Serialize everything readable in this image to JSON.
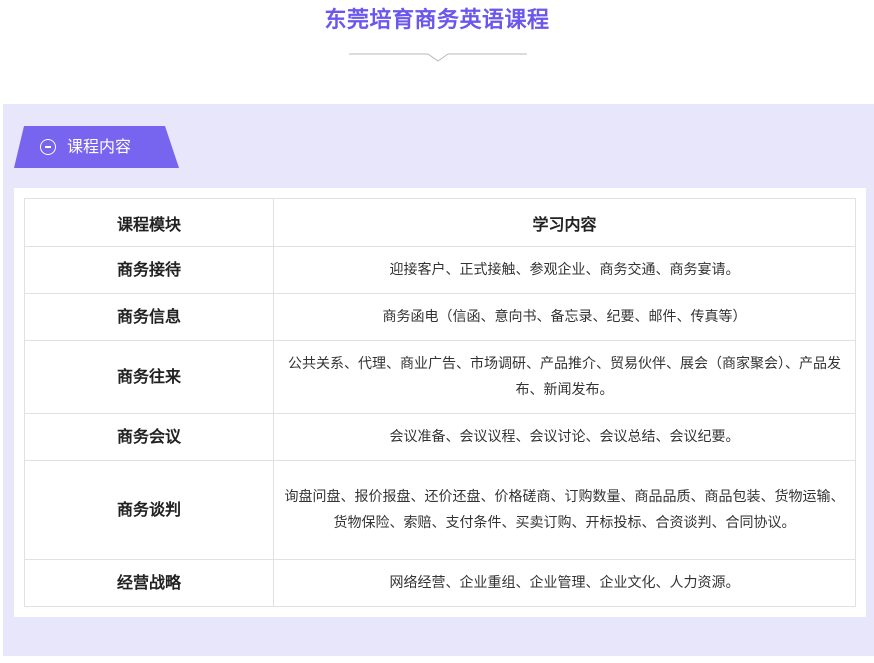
{
  "page": {
    "title": "东莞培育商务英语课程"
  },
  "section": {
    "tab_label": "课程内容",
    "icon": "minus-circle-icon"
  },
  "table": {
    "headers": {
      "module": "课程模块",
      "content": "学习内容"
    },
    "rows": [
      {
        "module": "商务接待",
        "content": "迎接客户、正式接触、参观企业、商务交通、商务宴请。"
      },
      {
        "module": "商务信息",
        "content": "商务函电（信函、意向书、备忘录、纪要、邮件、传真等）"
      },
      {
        "module": "商务往来",
        "content": "公共关系、代理、商业广告、市场调研、产品推介、贸易伙伴、展会（商家聚会）、产品发布、新闻发布。"
      },
      {
        "module": "商务会议",
        "content": "会议准备、会议议程、会议讨论、会议总结、会议纪要。"
      },
      {
        "module": "商务谈判",
        "content": "询盘问盘、报价报盘、还价还盘、价格磋商、订购数量、商品品质、商品包装、货物运输、货物保险、索赔、支付条件、买卖订购、开标投标、合资谈判、合同协议。"
      },
      {
        "module": "经营战略",
        "content": "网络经营、企业重组、企业管理、企业文化、人力资源。"
      }
    ]
  },
  "colors": {
    "accent": "#6b56ee",
    "panel_background": "#e8e6fb",
    "table_border": "#e1e1e1"
  }
}
